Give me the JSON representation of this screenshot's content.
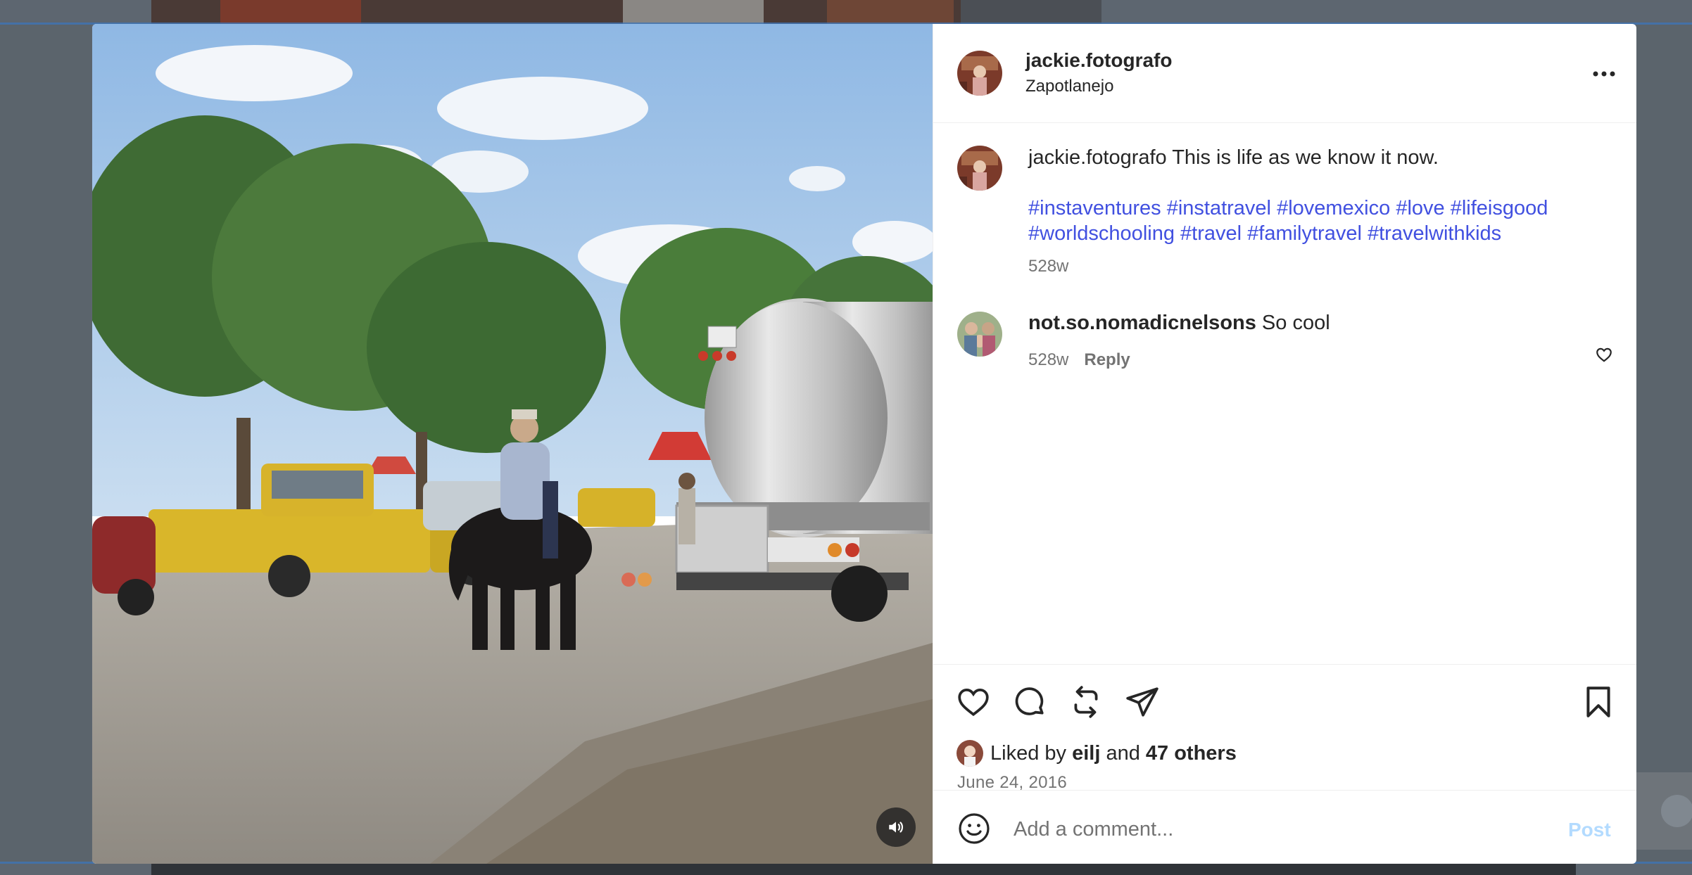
{
  "post": {
    "author": {
      "username": "jackie.fotografo",
      "location": "Zapotlanejo"
    },
    "caption": {
      "username": "jackie.fotografo",
      "text": " This is life as we know it now.",
      "hashtags": [
        "#instaventures",
        "#instatravel",
        "#lovemexico",
        "#love",
        "#lifeisgood",
        "#worldschooling",
        "#travel",
        "#familytravel",
        "#travelwithkids"
      ],
      "time": "528w"
    },
    "comments": [
      {
        "username": "not.so.nomadicnelsons",
        "text": " So cool",
        "time": "528w",
        "reply_label": "Reply"
      }
    ],
    "likes": {
      "prefix": "Liked by ",
      "first_user": "eilj",
      "connector": " and ",
      "others": "47 others"
    },
    "date": "June 24, 2016"
  },
  "composer": {
    "placeholder": "Add a comment...",
    "post_label": "Post"
  },
  "icons": {
    "more": "more-horizontal-icon",
    "like": "heart-icon",
    "comment": "comment-bubble-icon",
    "repost": "repost-icon",
    "share": "share-paper-plane-icon",
    "save": "bookmark-icon",
    "emoji": "emoji-smile-icon",
    "sound": "speaker-icon"
  },
  "colors": {
    "hashtag": "#4150e0",
    "post_button": "#b3dbff",
    "secondary_text": "#737373",
    "primary_text": "#262626"
  }
}
